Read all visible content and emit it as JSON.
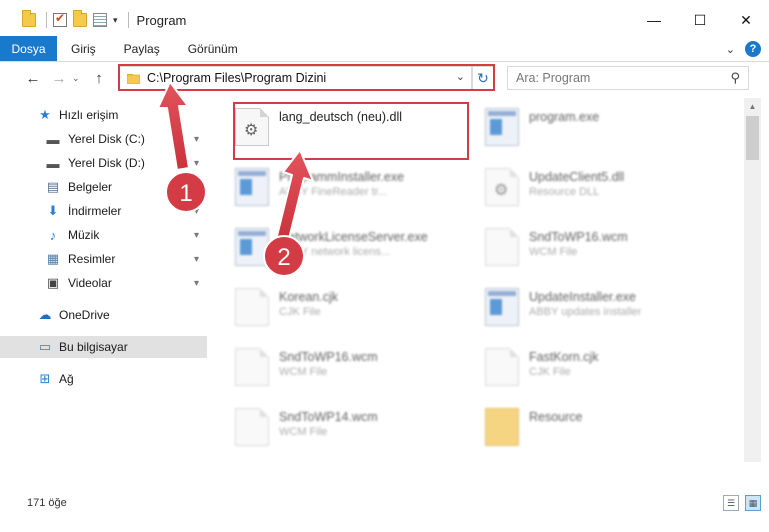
{
  "window": {
    "title": "Program",
    "minimize": "—",
    "maximize": "☐",
    "close": "✕"
  },
  "ribbon": {
    "file_tab": "Dosya",
    "tabs": [
      "Giriş",
      "Paylaş",
      "Görünüm"
    ],
    "collapse": "⌄",
    "help": "?"
  },
  "nav": {
    "back": "←",
    "forward": "→",
    "recent": "⌄",
    "up": "↑",
    "address": "C:\\Program Files\\Program Dizini",
    "address_dropdown": "⌄",
    "refresh": "↻",
    "search_placeholder": "Ara: Program",
    "search_icon": "⚲"
  },
  "sidebar": {
    "items": [
      {
        "label": "Hızlı erişim",
        "icon": "star-icon",
        "glyph": "★",
        "pinned": false
      },
      {
        "label": "Yerel Disk (C:)",
        "icon": "drive-icon",
        "glyph": "▬",
        "pinned": true
      },
      {
        "label": "Yerel Disk (D:)",
        "icon": "drive-icon",
        "glyph": "▬",
        "pinned": true
      },
      {
        "label": "Belgeler",
        "icon": "documents-icon",
        "glyph": "▤",
        "pinned": true
      },
      {
        "label": "İndirmeler",
        "icon": "download-icon",
        "glyph": "⬇",
        "pinned": true
      },
      {
        "label": "Müzik",
        "icon": "music-icon",
        "glyph": "♪",
        "pinned": true
      },
      {
        "label": "Resimler",
        "icon": "pictures-icon",
        "glyph": "▦",
        "pinned": true
      },
      {
        "label": "Videolar",
        "icon": "video-icon",
        "glyph": "▣",
        "pinned": true
      },
      {
        "label": "OneDrive",
        "icon": "cloud-icon",
        "glyph": "☁",
        "pinned": false
      },
      {
        "label": "Bu bilgisayar",
        "icon": "computer-icon",
        "glyph": "▭",
        "pinned": false
      },
      {
        "label": "Ağ",
        "icon": "network-icon",
        "glyph": "⊞",
        "pinned": false
      }
    ],
    "pin_glyph": "📌"
  },
  "files": [
    {
      "name": "lang_deutsch (neu).dll",
      "sub": "",
      "icon": "dll",
      "blur": false
    },
    {
      "name": "program.exe",
      "sub": "",
      "icon": "exe",
      "blur": true
    },
    {
      "name": "ProgrammInstaller.exe",
      "sub": "ABBY FineReader tr...",
      "icon": "exe",
      "blur": true
    },
    {
      "name": "UpdateClient5.dll",
      "sub": "Resource DLL",
      "icon": "dll",
      "blur": true
    },
    {
      "name": "NetworkLicenseServer.exe",
      "sub": "ABBY network licens...",
      "icon": "exe",
      "blur": true
    },
    {
      "name": "SndToWP16.wcm",
      "sub": "WCM File",
      "icon": "doc",
      "blur": true
    },
    {
      "name": "Korean.cjk",
      "sub": "CJK File",
      "icon": "doc",
      "blur": true
    },
    {
      "name": "UpdateInstaller.exe",
      "sub": "ABBY updates installer",
      "icon": "exe",
      "blur": true
    },
    {
      "name": "SndToWP16.wcm",
      "sub": "WCM File",
      "icon": "doc",
      "blur": true
    },
    {
      "name": "FastKorn.cjk",
      "sub": "CJK File",
      "icon": "doc",
      "blur": true
    },
    {
      "name": "SndToWP14.wcm",
      "sub": "WCM File",
      "icon": "doc",
      "blur": true
    },
    {
      "name": "Resource",
      "sub": "",
      "icon": "folder",
      "blur": true
    }
  ],
  "status": {
    "count": "171 öğe"
  },
  "annotations": {
    "step1": "1",
    "step2": "2",
    "accent": "#d43c45"
  }
}
